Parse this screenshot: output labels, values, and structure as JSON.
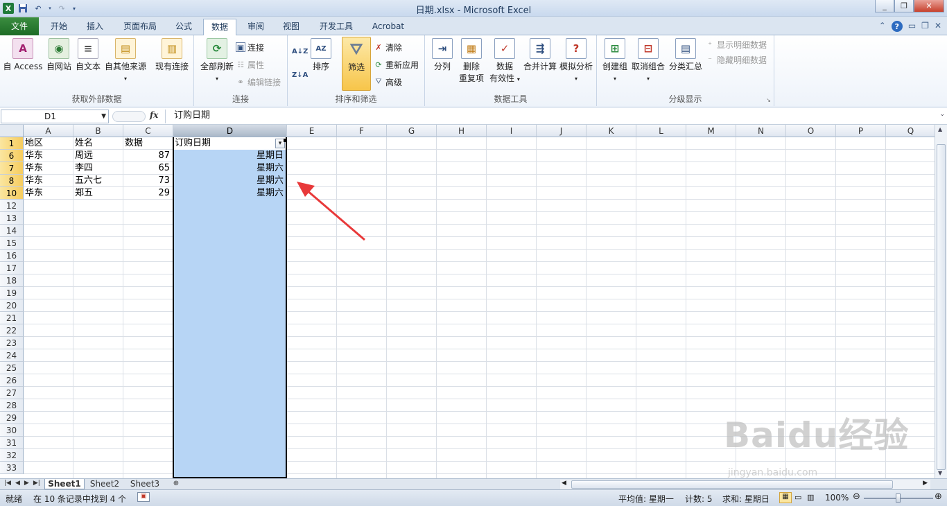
{
  "window": {
    "title": "日期.xlsx - Microsoft Excel"
  },
  "tabs": [
    {
      "label": "文件"
    },
    {
      "label": "开始"
    },
    {
      "label": "插入"
    },
    {
      "label": "页面布局"
    },
    {
      "label": "公式"
    },
    {
      "label": "数据"
    },
    {
      "label": "审阅"
    },
    {
      "label": "视图"
    },
    {
      "label": "开发工具"
    },
    {
      "label": "Acrobat"
    }
  ],
  "active_tab": "数据",
  "ribbon": {
    "external": {
      "label": "获取外部数据",
      "access": "自 Access",
      "web": "自网站",
      "text": "自文本",
      "other": "自其他来源",
      "existing": "现有连接"
    },
    "connections": {
      "label": "连接",
      "refresh": "全部刷新",
      "connect": "连接",
      "props": "属性",
      "edit_links": "编辑链接"
    },
    "sortfilter": {
      "label": "排序和筛选",
      "sort": "排序",
      "filter": "筛选",
      "clear": "清除",
      "reapply": "重新应用",
      "advanced": "高级"
    },
    "datatools": {
      "label": "数据工具",
      "split": "分列",
      "remove_dup_1": "删除",
      "remove_dup_2": "重复项",
      "validation_1": "数据",
      "validation_2": "有效性",
      "consolidate": "合并计算",
      "whatif": "模拟分析"
    },
    "outline": {
      "label": "分级显示",
      "group": "创建组",
      "ungroup": "取消组合",
      "subtotal": "分类汇总",
      "show_detail": "显示明细数据",
      "hide_detail": "隐藏明细数据"
    }
  },
  "formula_bar": {
    "name_box": "D1",
    "fx": "fx",
    "content": "订购日期"
  },
  "columns": [
    "A",
    "B",
    "C",
    "D",
    "E",
    "F",
    "G",
    "H",
    "I",
    "J",
    "K",
    "L",
    "M",
    "N",
    "O",
    "P",
    "Q"
  ],
  "rows": [
    "1",
    "6",
    "7",
    "8",
    "10",
    "12",
    "13",
    "14",
    "15",
    "16",
    "17",
    "18",
    "19",
    "20",
    "21",
    "22",
    "23",
    "24",
    "25",
    "26",
    "27",
    "28",
    "29",
    "30",
    "31",
    "32",
    "33"
  ],
  "cells": {
    "header": [
      "地区",
      "姓名",
      "数据",
      "订购日期"
    ],
    "data": [
      [
        "华东",
        "周远",
        "87",
        "星期日"
      ],
      [
        "华东",
        "李四",
        "65",
        "星期六"
      ],
      [
        "华东",
        "五六七",
        "73",
        "星期六"
      ],
      [
        "华东",
        "郑五",
        "29",
        "星期六"
      ]
    ]
  },
  "sheets": [
    "Sheet1",
    "Sheet2",
    "Sheet3"
  ],
  "active_sheet": "Sheet1",
  "status": {
    "mode": "就绪",
    "filter_info": "在 10 条记录中找到 4 个",
    "average": "平均值: 星期一",
    "count": "计数: 5",
    "sum": "求和: 星期日",
    "zoom": "100%"
  },
  "watermark": {
    "brand": "Baidu经验",
    "url": "jingyan.baidu.com"
  },
  "colors": {
    "selection": "#b7d5f5",
    "file_tab": "#1d6b26",
    "annotation_arrow": "#e8393a",
    "selected_row_header": "#f6cc5e"
  }
}
